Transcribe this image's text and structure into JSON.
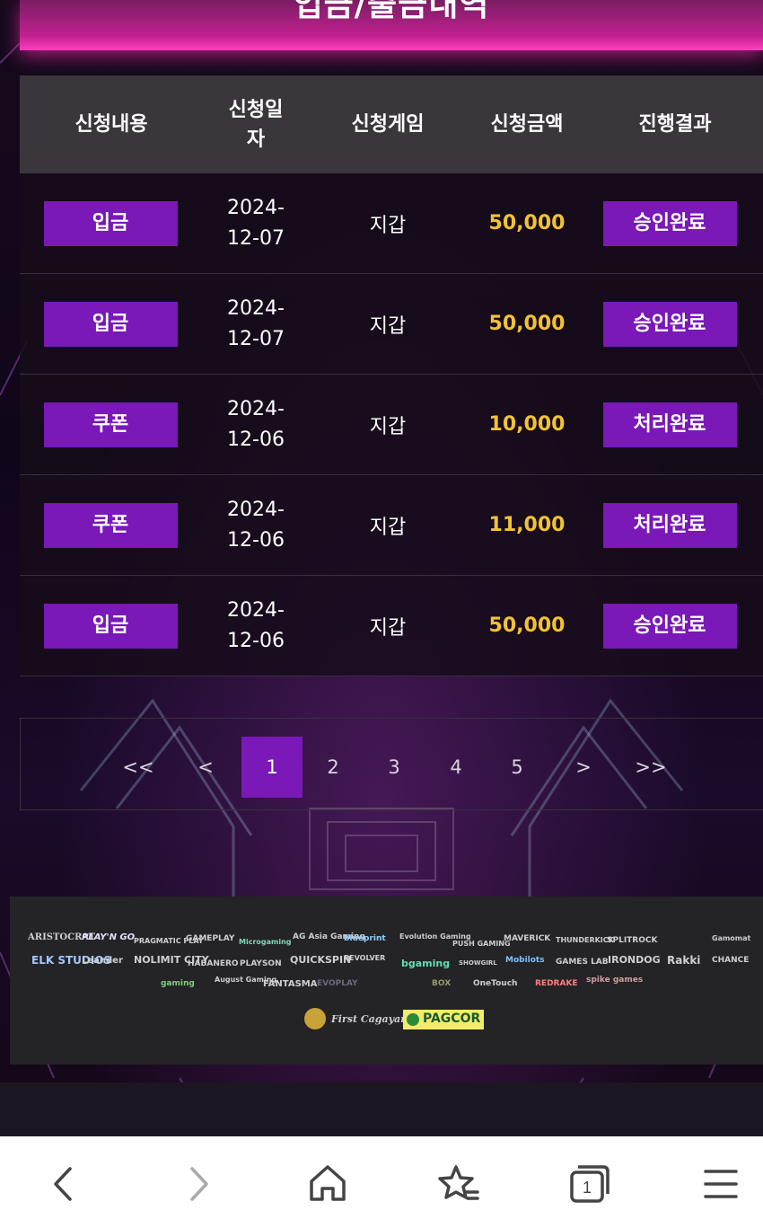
{
  "page": {
    "title": "입금/출금내역"
  },
  "table": {
    "headers": [
      "신청내용",
      "신청일자",
      "신청게임",
      "신청금액",
      "진행결과"
    ],
    "header_date_lines": [
      "신청일",
      "자"
    ],
    "rows": [
      {
        "type": "입금",
        "date1": "2024-",
        "date2": "12-07",
        "game": "지갑",
        "amount": "50,000",
        "result": "승인완료"
      },
      {
        "type": "입금",
        "date1": "2024-",
        "date2": "12-07",
        "game": "지갑",
        "amount": "50,000",
        "result": "승인완료"
      },
      {
        "type": "쿠폰",
        "date1": "2024-",
        "date2": "12-06",
        "game": "지갑",
        "amount": "10,000",
        "result": "처리완료"
      },
      {
        "type": "쿠폰",
        "date1": "2024-",
        "date2": "12-06",
        "game": "지갑",
        "amount": "11,000",
        "result": "처리완료"
      },
      {
        "type": "입금",
        "date1": "2024-",
        "date2": "12-06",
        "game": "지갑",
        "amount": "50,000",
        "result": "승인완료"
      }
    ]
  },
  "pagination": {
    "first": "<<",
    "prev": "<",
    "next": ">",
    "last": ">>",
    "pages": [
      "1",
      "2",
      "3",
      "4",
      "5"
    ],
    "current": "1"
  },
  "footer": {
    "providers": [
      "ARISTOCRAT",
      "PLAY'N GO",
      "PRAGMATIC PLAY",
      "GAMEPLAY",
      "Microgaming",
      "AG Asia Gaming",
      "blueprint",
      "Evolution Gaming",
      "PUSH GAMING",
      "MAVERICK",
      "THUNDERKICK",
      "SPLITROCK",
      "Gamomat",
      "ELK STUDIOS",
      "Leander",
      "NOLIMIT CITY",
      "HABANERO",
      "PLAYSON",
      "QUICKSPIN",
      "REVOLVER",
      "bgaming",
      "SHOWGIRL",
      "Mobilots",
      "GAMES LAB",
      "IRONDOG",
      "Rakki",
      "CHANCE",
      "gaming",
      "August Gaming",
      "FANTASMA",
      "EVOPLAY",
      "BOX",
      "OneTouch",
      "REDRAKE",
      "spike games"
    ],
    "license_left": "First Cagayan",
    "license_right": "PAGCOR"
  },
  "browser_nav": {
    "back": "back-icon",
    "forward": "forward-icon",
    "home": "home-icon",
    "bookmarks": "bookmark-star-icon",
    "tabs_count": "1",
    "menu": "menu-icon"
  },
  "colors": {
    "accent": "#7a18b8",
    "amount": "#f2c233",
    "header_bg": "#3a363c",
    "title_glow": "#ff3fc0"
  }
}
